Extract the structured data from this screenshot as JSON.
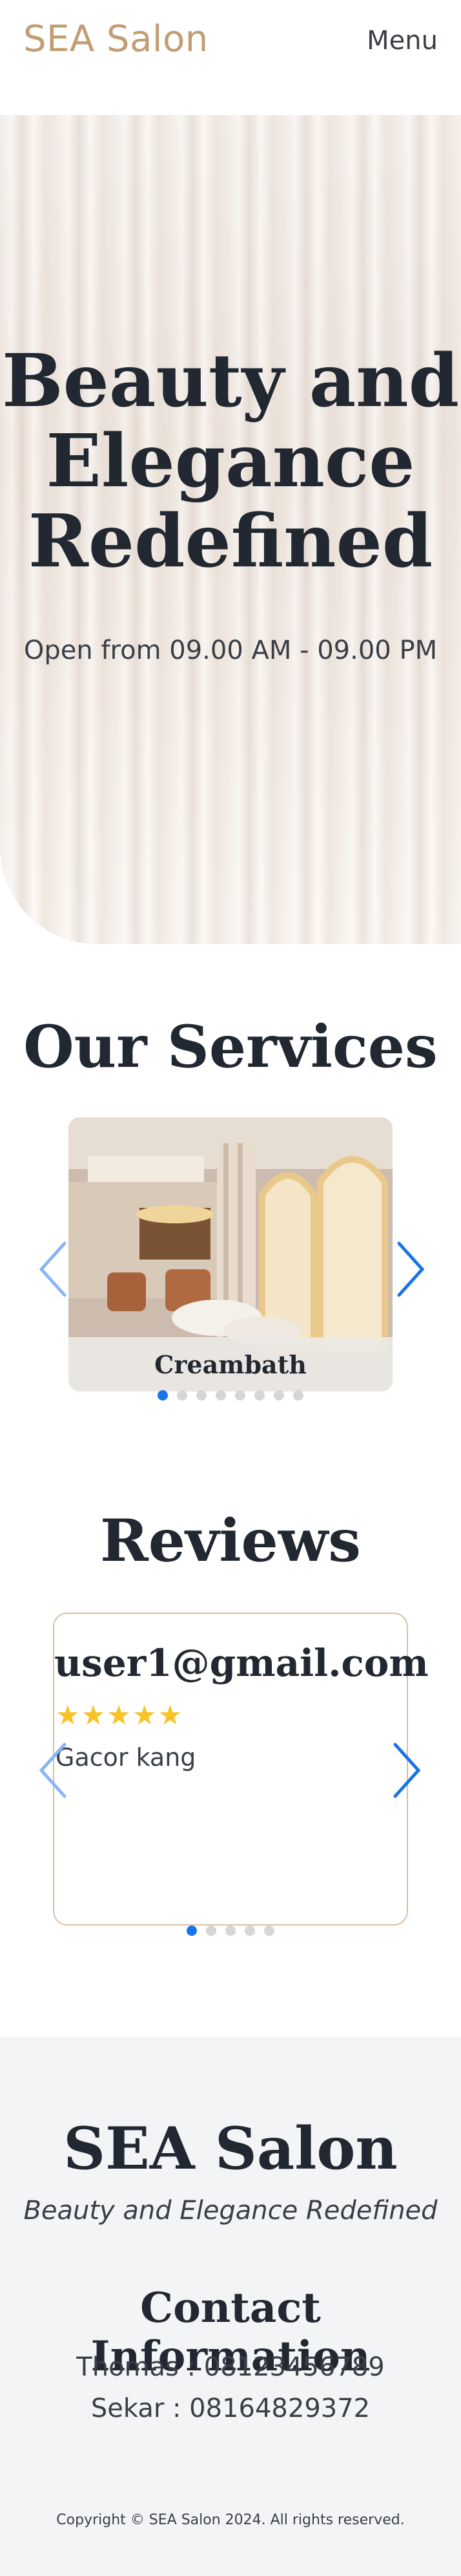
{
  "header": {
    "brand": "SEA Salon",
    "menu_label": "Menu"
  },
  "hero": {
    "title_lines": [
      "Beauty and",
      "Elegance",
      "Redefined"
    ],
    "subtitle": "Open from 09.00 AM - 09.00 PM"
  },
  "services": {
    "title": "Our Services",
    "current_caption": "Creambath",
    "slide_count": 8,
    "active_index": 0,
    "arrow_color": "#1a73e8"
  },
  "reviews": {
    "title": "Reviews",
    "current": {
      "user": "user1@gmail.com",
      "stars": "★★★★★",
      "rating": 5,
      "text": "Gacor kang"
    },
    "slide_count": 5,
    "active_index": 0
  },
  "footer": {
    "brand": "SEA Salon",
    "tagline": "Beauty and Elegance Redefined",
    "contact_title": "Contact Information",
    "contacts": [
      "Thomas : 08123456789",
      "Sekar : 08164829372"
    ],
    "copyright": "Copyright © SEA Salon 2024. All rights reserved."
  },
  "colors": {
    "brand": "#c29d73",
    "text_dark": "#222831",
    "star": "#f7c325",
    "dot_active": "#1a73e8",
    "dot_inactive": "#d6d6d6",
    "footer_bg": "#f3f4f6"
  }
}
